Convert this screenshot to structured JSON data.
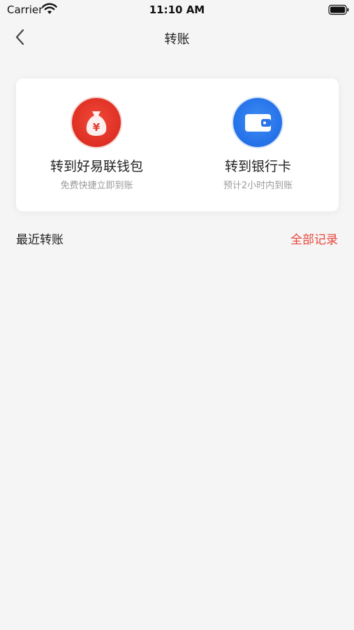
{
  "status_bar": {
    "carrier": "Carrier",
    "time": "11:10 AM"
  },
  "nav": {
    "title": "转账",
    "back_icon": "chevron-left-icon"
  },
  "transfer_options": [
    {
      "title": "转到好易联钱包",
      "subtitle": "免费快捷立即到账",
      "icon": "money-bag-icon",
      "color": "#e23a2e"
    },
    {
      "title": "转到银行卡",
      "subtitle": "预计2小时内到账",
      "icon": "wallet-icon",
      "color": "#2b74ea"
    }
  ],
  "recent": {
    "title": "最近转账",
    "all_records_label": "全部记录",
    "accent_color": "#e8453a"
  }
}
